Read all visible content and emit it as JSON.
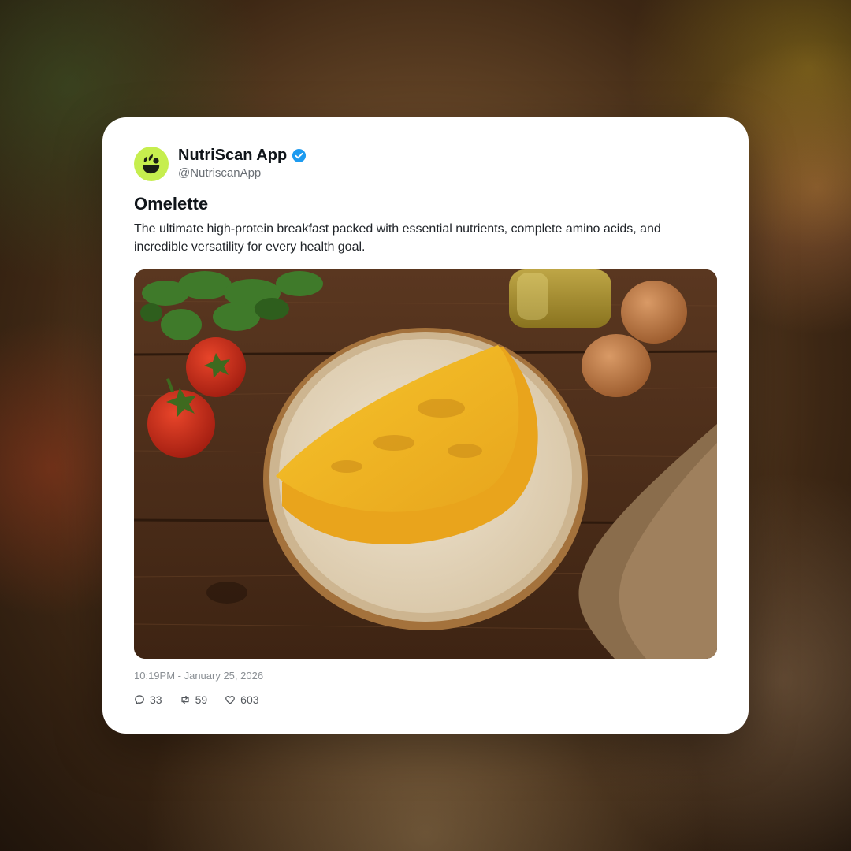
{
  "post": {
    "author": {
      "display_name": "NutriScan App",
      "handle": "@NutriscanApp",
      "verified": true,
      "avatar_icon": "leaf-logo-icon",
      "avatar_color": "#c6ee4e"
    },
    "title": "Omelette",
    "body": "The ultimate high-protein breakfast packed with essential nutrients, complete amino acids, and incredible versatility for every health goal.",
    "image": {
      "subject": "omelette-photo",
      "icon": "food-photo"
    },
    "timestamp": "10:19PM - January 25, 2026",
    "stats": {
      "replies": "33",
      "reposts": "59",
      "likes": "603"
    }
  },
  "colors": {
    "verified_badge": "#1d9bf0",
    "card_background": "#ffffff",
    "avatar": "#c6ee4e"
  }
}
